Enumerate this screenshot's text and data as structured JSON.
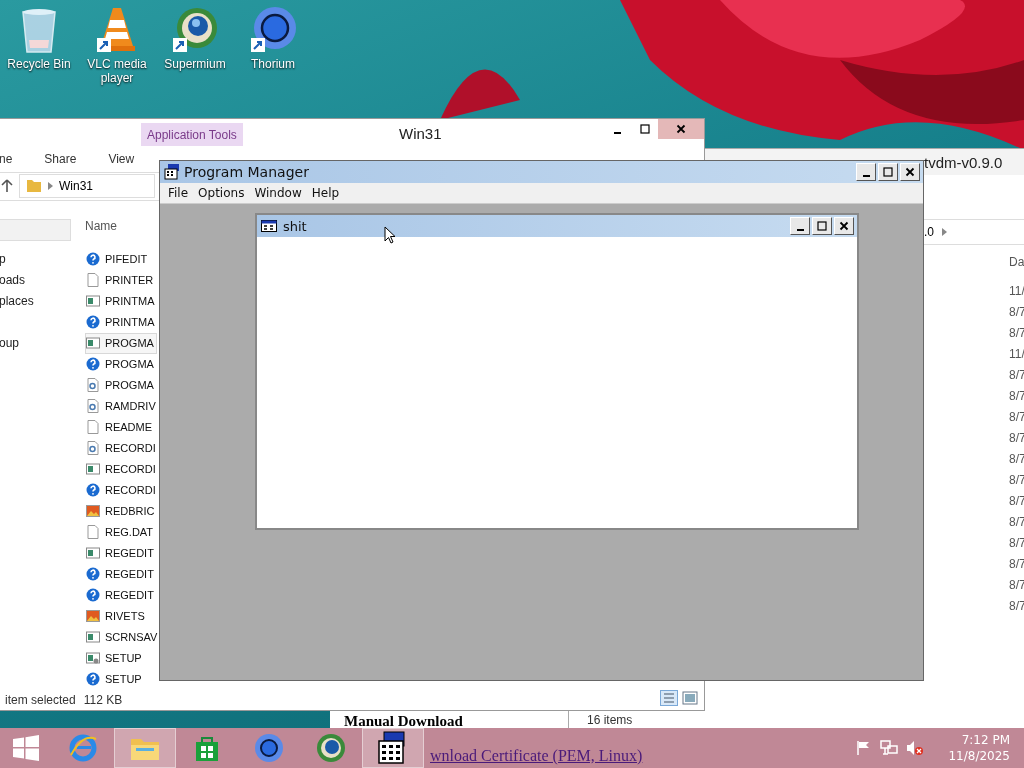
{
  "desktop_icons": [
    {
      "label": "Recycle Bin",
      "kind": "bin"
    },
    {
      "label": "VLC media player",
      "kind": "cone"
    },
    {
      "label": "Supermium",
      "kind": "supermium"
    },
    {
      "label": "Thorium",
      "kind": "thorium"
    }
  ],
  "explorer_right": {
    "title": "tvdm-v0.9.0",
    "address": ".0",
    "column": "Da",
    "dates": [
      "11/",
      "8/7",
      "8/7",
      "11/",
      "8/7",
      "8/7",
      "8/7",
      "8/7",
      "8/7",
      "8/7",
      "8/7",
      "8/7",
      "8/7",
      "8/7",
      "8/7",
      "8/7"
    ],
    "status": "16 items"
  },
  "browser_page": {
    "heading": "Manual Download",
    "link": "wnload Certificate (PEM, Linux)"
  },
  "explorer_left": {
    "title": "Win31",
    "context_tab": "Application Tools",
    "ribbon_tabs": [
      "ne",
      "Share",
      "View"
    ],
    "address": "Win31",
    "nav_items": [
      "p",
      "oads",
      "places",
      "oup"
    ],
    "column": "Name",
    "files": [
      {
        "name": "PIFEDIT",
        "kind": "help",
        "selected": false
      },
      {
        "name": "PRINTER",
        "kind": "doc",
        "selected": false
      },
      {
        "name": "PRINTMA",
        "kind": "exe",
        "selected": false
      },
      {
        "name": "PRINTMA",
        "kind": "help",
        "selected": false
      },
      {
        "name": "PROGMA",
        "kind": "exe",
        "selected": true
      },
      {
        "name": "PROGMA",
        "kind": "help",
        "selected": false
      },
      {
        "name": "PROGMA",
        "kind": "config",
        "selected": false
      },
      {
        "name": "RAMDRIV",
        "kind": "config",
        "selected": false
      },
      {
        "name": "README",
        "kind": "doc",
        "selected": false
      },
      {
        "name": "RECORDI",
        "kind": "config",
        "selected": false
      },
      {
        "name": "RECORDI",
        "kind": "exe",
        "selected": false
      },
      {
        "name": "RECORDI",
        "kind": "help",
        "selected": false
      },
      {
        "name": "REDBRIC",
        "kind": "image",
        "selected": false
      },
      {
        "name": "REG.DAT",
        "kind": "doc",
        "selected": false
      },
      {
        "name": "REGEDIT",
        "kind": "exe",
        "selected": false
      },
      {
        "name": "REGEDIT",
        "kind": "help",
        "selected": false
      },
      {
        "name": "REGEDIT",
        "kind": "help",
        "selected": false
      },
      {
        "name": "RIVETS",
        "kind": "image",
        "selected": false
      },
      {
        "name": "SCRNSAV",
        "kind": "exe",
        "selected": false
      },
      {
        "name": "SETUP",
        "kind": "setup",
        "selected": false
      },
      {
        "name": "SETUP",
        "kind": "help",
        "selected": false
      }
    ],
    "status": "item selected",
    "size": "112 KB"
  },
  "program_manager": {
    "title": "Program Manager",
    "menu": [
      "File",
      "Options",
      "Window",
      "Help"
    ],
    "group_window": {
      "title": "shit"
    }
  },
  "taskbar": {
    "apps": [
      {
        "kind": "ie",
        "open": false
      },
      {
        "kind": "explorer",
        "open": true
      },
      {
        "kind": "store",
        "open": false
      },
      {
        "kind": "thorium",
        "open": false
      },
      {
        "kind": "supermium",
        "open": false
      },
      {
        "kind": "progman",
        "open": true
      }
    ],
    "time": "7:12 PM",
    "date": "11/8/2025"
  }
}
